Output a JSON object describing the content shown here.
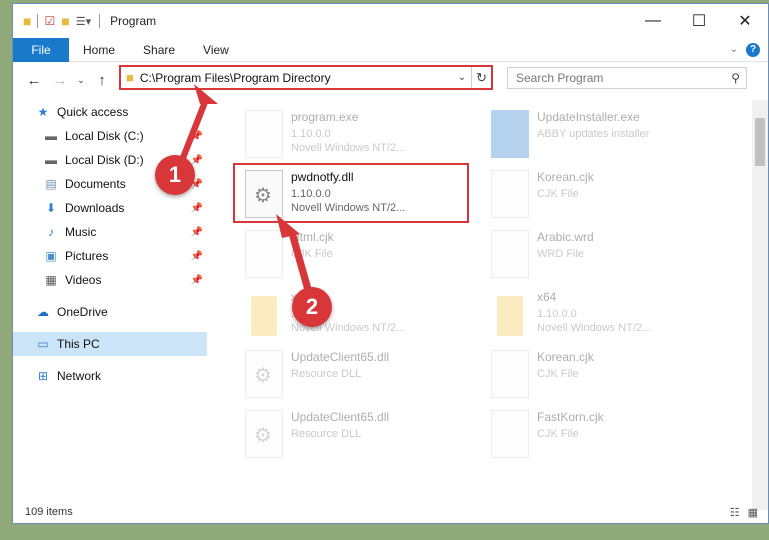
{
  "window": {
    "title": "Program"
  },
  "ribbon": {
    "tabs": [
      "File",
      "Home",
      "Share",
      "View"
    ]
  },
  "address": {
    "path": "C:\\Program Files\\Program Directory"
  },
  "search": {
    "placeholder": "Search Program"
  },
  "sidebar": {
    "items": [
      {
        "label": "Quick access",
        "icon": "star-icon"
      },
      {
        "label": "Local Disk (C:)",
        "icon": "drive-icon",
        "pinned": true
      },
      {
        "label": "Local Disk (D:)",
        "icon": "drive-icon",
        "pinned": true
      },
      {
        "label": "Documents",
        "icon": "documents-icon",
        "pinned": true
      },
      {
        "label": "Downloads",
        "icon": "download-icon",
        "pinned": true
      },
      {
        "label": "Music",
        "icon": "music-icon",
        "pinned": true
      },
      {
        "label": "Pictures",
        "icon": "pictures-icon",
        "pinned": true
      },
      {
        "label": "Videos",
        "icon": "videos-icon",
        "pinned": true
      },
      {
        "label": "OneDrive",
        "icon": "cloud-icon"
      },
      {
        "label": "This PC",
        "icon": "computer-icon"
      },
      {
        "label": "Network",
        "icon": "network-icon"
      }
    ]
  },
  "files": [
    {
      "name": "program.exe",
      "line1": "1.10.0.0",
      "line2": "Novell Windows NT/2...",
      "faded": true
    },
    {
      "name": "UpdateInstaller.exe",
      "line1": "ABBY updates installer",
      "line2": "",
      "faded": true
    },
    {
      "name": "pwdnotfy.dll",
      "line1": "1.10.0.0",
      "line2": "Novell Windows NT/2...",
      "faded": false
    },
    {
      "name": "Korean.cjk",
      "line1": "CJK File",
      "line2": "",
      "faded": true
    },
    {
      "name": "Html.cjk",
      "line1": "CJK File",
      "line2": "",
      "faded": true
    },
    {
      "name": "Arabic.wrd",
      "line1": "WRD File",
      "line2": "",
      "faded": true
    },
    {
      "name": "x64",
      "line1": "1.10.0.0",
      "line2": "Novell Windows NT/2...",
      "faded": true
    },
    {
      "name": "x64",
      "line1": "1.10.0.0",
      "line2": "Novell Windows NT/2...",
      "faded": true
    },
    {
      "name": "UpdateClient65.dll",
      "line1": "Resource DLL",
      "line2": "",
      "faded": true
    },
    {
      "name": "Korean.cjk",
      "line1": "CJK File",
      "line2": "",
      "faded": true
    },
    {
      "name": "UpdateClient65.dll",
      "line1": "Resource DLL",
      "line2": "",
      "faded": true
    },
    {
      "name": "FastKorn.cjk",
      "line1": "CJK File",
      "line2": "",
      "faded": true
    }
  ],
  "status": {
    "count": "109 items"
  },
  "badges": {
    "one": "1",
    "two": "2"
  },
  "colors": {
    "accent": "#1979ca",
    "highlight": "#d9363a"
  }
}
